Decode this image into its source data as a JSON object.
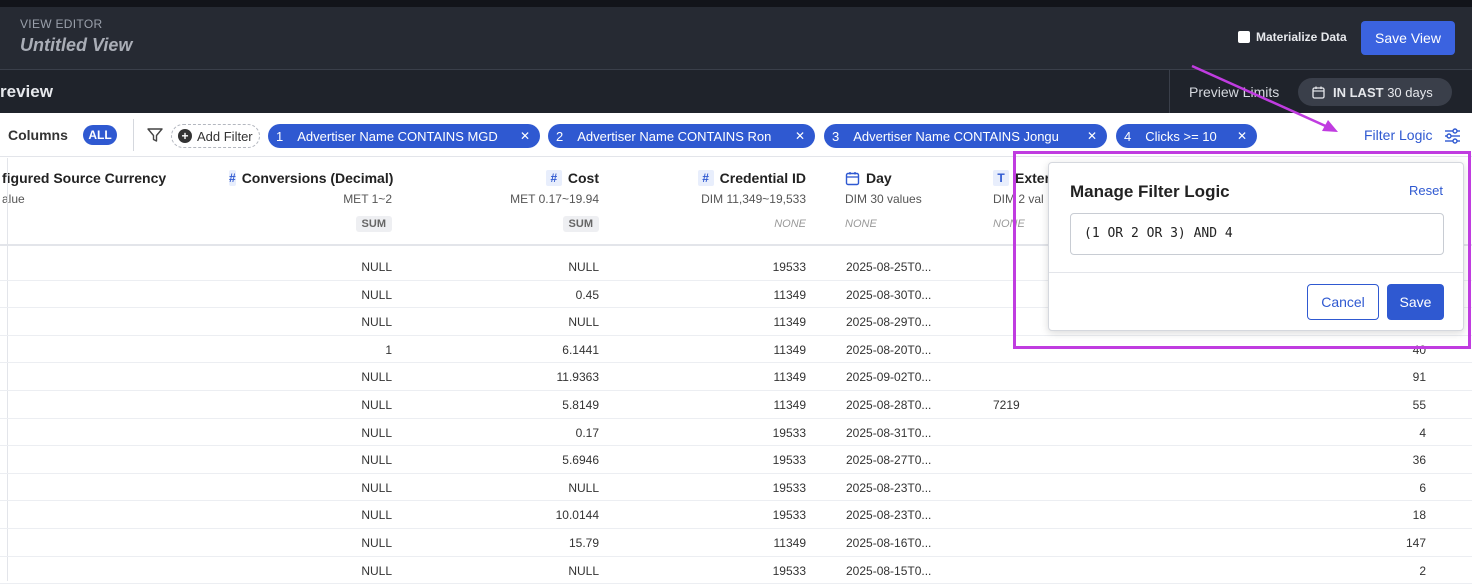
{
  "header": {
    "section": "VIEW EDITOR",
    "title": "Untitled View",
    "materialize_label": "Materialize Data",
    "save_label": "Save View"
  },
  "preview": {
    "title": "review",
    "limits_label": "Preview Limits",
    "limit_prefix": "IN LAST",
    "limit_value": "30 days"
  },
  "filterbar": {
    "columns_label": "Columns",
    "all_label": "ALL",
    "add_filter_label": "Add Filter",
    "filters": [
      {
        "num": "1",
        "label": "Advertiser Name CONTAINS MGD"
      },
      {
        "num": "2",
        "label": "Advertiser Name CONTAINS Ron"
      },
      {
        "num": "3",
        "label": "Advertiser Name CONTAINS Jongu"
      },
      {
        "num": "4",
        "label": "Clicks >= 10"
      }
    ],
    "filter_logic_label": "Filter Logic"
  },
  "columns": [
    {
      "icon": "",
      "name": "figured Source Currency",
      "meta": "alue",
      "agg": ""
    },
    {
      "icon": "#",
      "name": "Conversions (Decimal)",
      "meta": "MET  1~2",
      "agg": "SUM"
    },
    {
      "icon": "#",
      "name": "Cost",
      "meta": "MET  0.17~19.94",
      "agg": "SUM"
    },
    {
      "icon": "#",
      "name": "Credential ID",
      "meta": "DIM  11,349~19,533",
      "agg": "NONE"
    },
    {
      "icon": "calendar",
      "name": "Day",
      "meta": "DIM  30 values",
      "agg": "NONE"
    },
    {
      "icon": "T",
      "name": "Exter",
      "meta": "DIM  2 val",
      "agg": "NONE"
    }
  ],
  "rows": [
    [
      "NULL",
      "NULL",
      "19533",
      "2025-08-25T0...",
      "",
      ""
    ],
    [
      "NULL",
      "0.45",
      "11349",
      "2025-08-30T0...",
      "",
      ""
    ],
    [
      "NULL",
      "NULL",
      "11349",
      "2025-08-29T0...",
      "",
      ""
    ],
    [
      "1",
      "6.1441",
      "11349",
      "2025-08-20T0...",
      "",
      "40"
    ],
    [
      "NULL",
      "11.9363",
      "11349",
      "2025-09-02T0...",
      "",
      "91"
    ],
    [
      "NULL",
      "5.8149",
      "11349",
      "2025-08-28T0...",
      "7219",
      "55"
    ],
    [
      "NULL",
      "0.17",
      "19533",
      "2025-08-31T0...",
      "",
      "4"
    ],
    [
      "NULL",
      "5.6946",
      "19533",
      "2025-08-27T0...",
      "",
      "36"
    ],
    [
      "NULL",
      "NULL",
      "19533",
      "2025-08-23T0...",
      "",
      "6"
    ],
    [
      "NULL",
      "10.0144",
      "19533",
      "2025-08-23T0...",
      "",
      "18"
    ],
    [
      "NULL",
      "15.79",
      "11349",
      "2025-08-16T0...",
      "",
      "147"
    ],
    [
      "NULL",
      "NULL",
      "19533",
      "2025-08-15T0...",
      "",
      "2"
    ]
  ],
  "popup": {
    "title": "Manage Filter Logic",
    "reset_label": "Reset",
    "logic_value": "(1 OR 2 OR 3) AND 4",
    "cancel_label": "Cancel",
    "save_label": "Save"
  },
  "colors": {
    "accent": "#2f59d1",
    "highlight": "#c03ce0",
    "header_bg": "#262a33"
  }
}
